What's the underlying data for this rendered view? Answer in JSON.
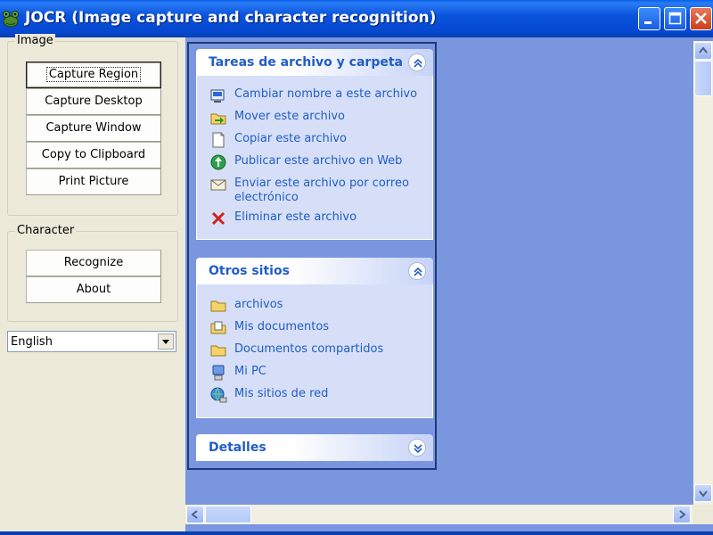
{
  "window": {
    "title": "JOCR (Image capture and character recognition)",
    "icon": "frog-icon"
  },
  "image_group": {
    "legend": "Image",
    "buttons": [
      {
        "label": "Capture Region",
        "focused": true
      },
      {
        "label": "Capture Desktop"
      },
      {
        "label": "Capture Window"
      },
      {
        "label": "Copy to Clipboard"
      },
      {
        "label": "Print Picture"
      }
    ]
  },
  "character_group": {
    "legend": "Character",
    "buttons": [
      {
        "label": "Recognize"
      },
      {
        "label": "About"
      }
    ]
  },
  "language_select": {
    "value": "English"
  },
  "task_panel": {
    "sections": [
      {
        "title": "Tareas de archivo y carpeta",
        "expanded": true,
        "items": [
          {
            "label": "Cambiar nombre a este archivo",
            "icon": "rename-icon"
          },
          {
            "label": "Mover este archivo",
            "icon": "move-icon"
          },
          {
            "label": "Copiar este archivo",
            "icon": "copy-icon"
          },
          {
            "label": "Publicar este archivo en Web",
            "icon": "globe-icon"
          },
          {
            "label": "Enviar este archivo por correo electrónico",
            "icon": "mail-icon"
          },
          {
            "label": "Eliminar este archivo",
            "icon": "delete-icon"
          }
        ]
      },
      {
        "title": "Otros sitios",
        "expanded": true,
        "items": [
          {
            "label": "archivos",
            "icon": "folder-icon"
          },
          {
            "label": "Mis documentos",
            "icon": "my-documents-icon"
          },
          {
            "label": "Documentos compartidos",
            "icon": "folder-icon"
          },
          {
            "label": "Mi PC",
            "icon": "computer-icon"
          },
          {
            "label": "Mis sitios de red",
            "icon": "network-icon"
          }
        ]
      },
      {
        "title": "Detalles",
        "expanded": false,
        "items": []
      }
    ]
  },
  "colors": {
    "titlebar": "#0a54dc",
    "task_link": "#215dc6",
    "pane_background": "#7a96df"
  }
}
